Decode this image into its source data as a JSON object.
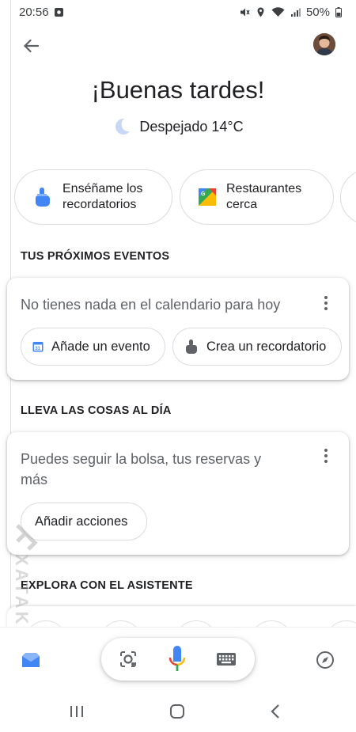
{
  "status_bar": {
    "time": "20:56",
    "battery": "50%"
  },
  "header": {
    "back_icon": "arrow-back-icon",
    "avatar_icon": "user-avatar"
  },
  "greeting": "¡Buenas tardes!",
  "weather": {
    "text": "Despejado 14°C",
    "icon": "moon-icon"
  },
  "chips": [
    {
      "line1": "Enséñame los",
      "line2": "recordatorios",
      "icon": "reminder-hand-icon"
    },
    {
      "line1": "Restaurantes",
      "line2": "cerca",
      "icon": "maps-icon"
    }
  ],
  "sections": {
    "events": {
      "title": "TUS PRÓXIMOS EVENTOS",
      "message": "No tienes nada en el calendario para hoy",
      "add_event": "Añade un evento",
      "create_reminder": "Crea un recordatorio"
    },
    "updates": {
      "title": "LLEVA LAS COSAS AL DÍA",
      "message": "Puedes seguir la bolsa, tus reservas y más",
      "add_actions": "Añadir acciones"
    },
    "explore": {
      "title": "EXPLORA CON EL ASISTENTE"
    }
  },
  "watermark": "XATAKA BASICS",
  "colors": {
    "google_blue": "#4285F4",
    "google_red": "#EA4335",
    "google_yellow": "#FBBC05",
    "google_green": "#34A853",
    "text_primary": "#202124",
    "text_secondary": "#5f6368"
  }
}
